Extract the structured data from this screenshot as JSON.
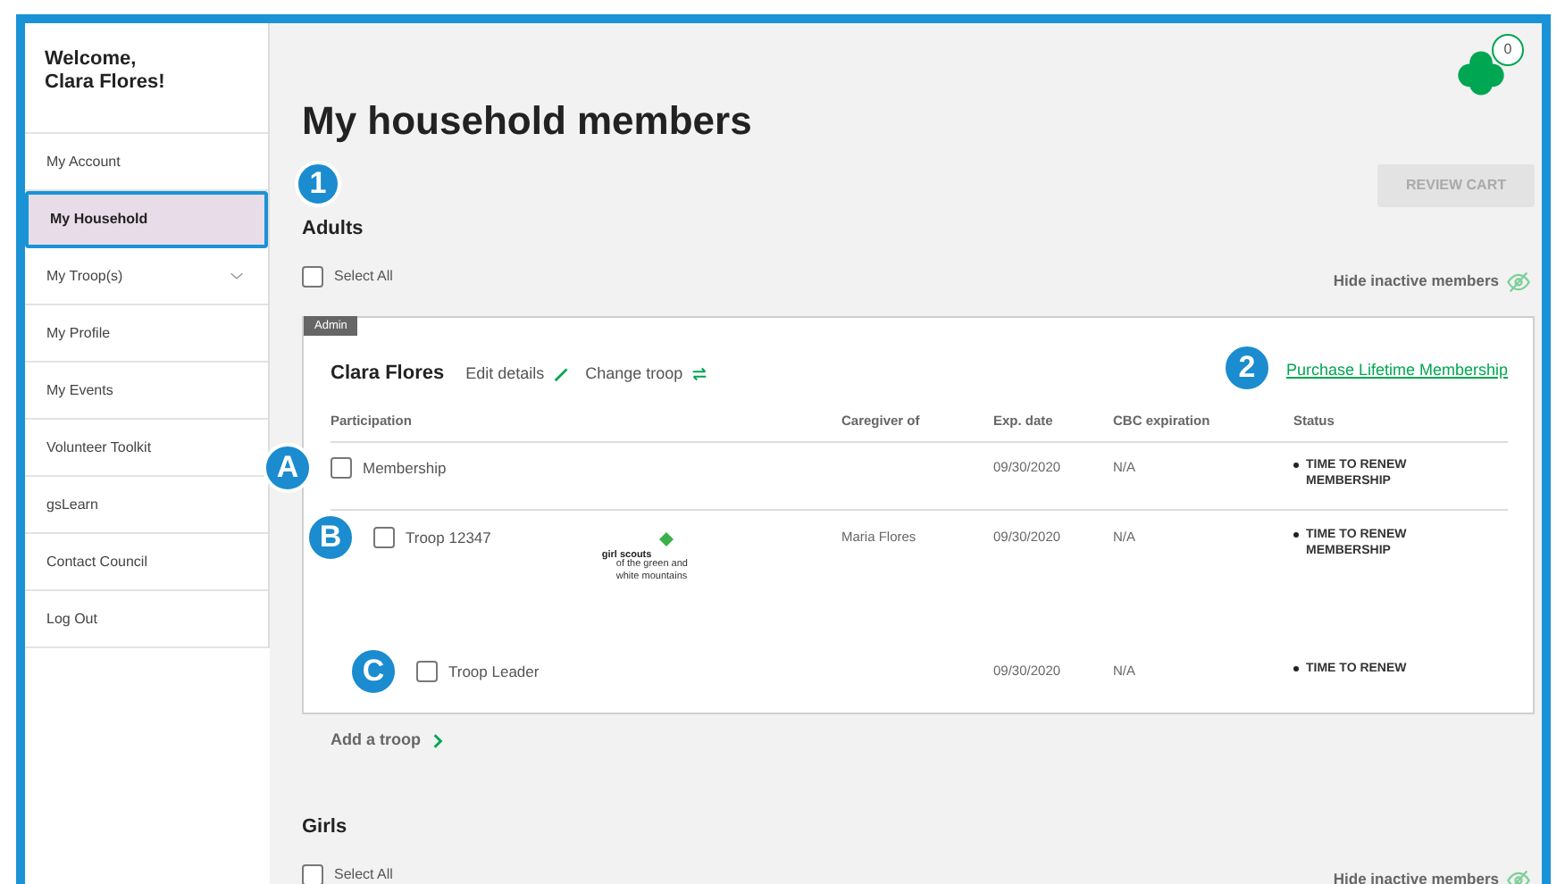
{
  "sidebar": {
    "welcome": "Welcome,\nClara Flores!",
    "items": [
      {
        "label": "My Account",
        "selected": false,
        "expandable": false
      },
      {
        "label": "My Household",
        "selected": true,
        "expandable": false
      },
      {
        "label": "My Troop(s)",
        "selected": false,
        "expandable": true
      },
      {
        "label": "My Profile",
        "selected": false,
        "expandable": false
      },
      {
        "label": "My Events",
        "selected": false,
        "expandable": false
      },
      {
        "label": "Volunteer Toolkit",
        "selected": false,
        "expandable": false
      },
      {
        "label": "gsLearn",
        "selected": false,
        "expandable": false
      },
      {
        "label": "Contact Council",
        "selected": false,
        "expandable": false
      },
      {
        "label": "Log Out",
        "selected": false,
        "expandable": false
      }
    ]
  },
  "header": {
    "title": "My household members",
    "cart_count": "0",
    "review_cart": {
      "label": "REVIEW CART",
      "disabled": true
    }
  },
  "adults": {
    "callout": "1",
    "heading": "Adults",
    "select_all": {
      "label": "Select All",
      "checked": false
    },
    "hide_inactive": "Hide inactive members",
    "member": {
      "tag": "Admin",
      "name": "Clara Flores",
      "edit": "Edit details",
      "change": "Change troop",
      "callout": "2",
      "link": "Purchase Lifetime Membership",
      "columns": [
        "Participation",
        "Caregiver of",
        "Exp. date",
        "CBC expiration",
        "Status"
      ],
      "rows": [
        {
          "kind": "membership",
          "callout": "A",
          "label": "Membership",
          "checked": false,
          "exp_date": "09/30/2020",
          "cbc": "N/A",
          "status": "TIME TO RENEW MEMBERSHIP"
        },
        {
          "kind": "troop",
          "callout": "B",
          "label": "Troop 12347",
          "checked": false,
          "logo": {
            "name": "girl scouts",
            "council": "of the green and\nwhite mountains"
          },
          "caregiver_of": "Maria Flores",
          "exp_date": "09/30/2020",
          "cbc": "N/A",
          "status": "TIME TO RENEW MEMBERSHIP",
          "children": [
            {
              "kind": "role",
              "callout": "C",
              "label": "Troop Leader",
              "checked": false,
              "exp_date": "09/30/2020",
              "cbc": "N/A",
              "status": "TIME TO RENEW"
            }
          ]
        }
      ]
    },
    "add_troop": "Add a troop"
  },
  "girls": {
    "heading": "Girls",
    "select_all": {
      "label": "Select All",
      "checked": false
    },
    "hide_inactive": "Hide inactive members"
  }
}
